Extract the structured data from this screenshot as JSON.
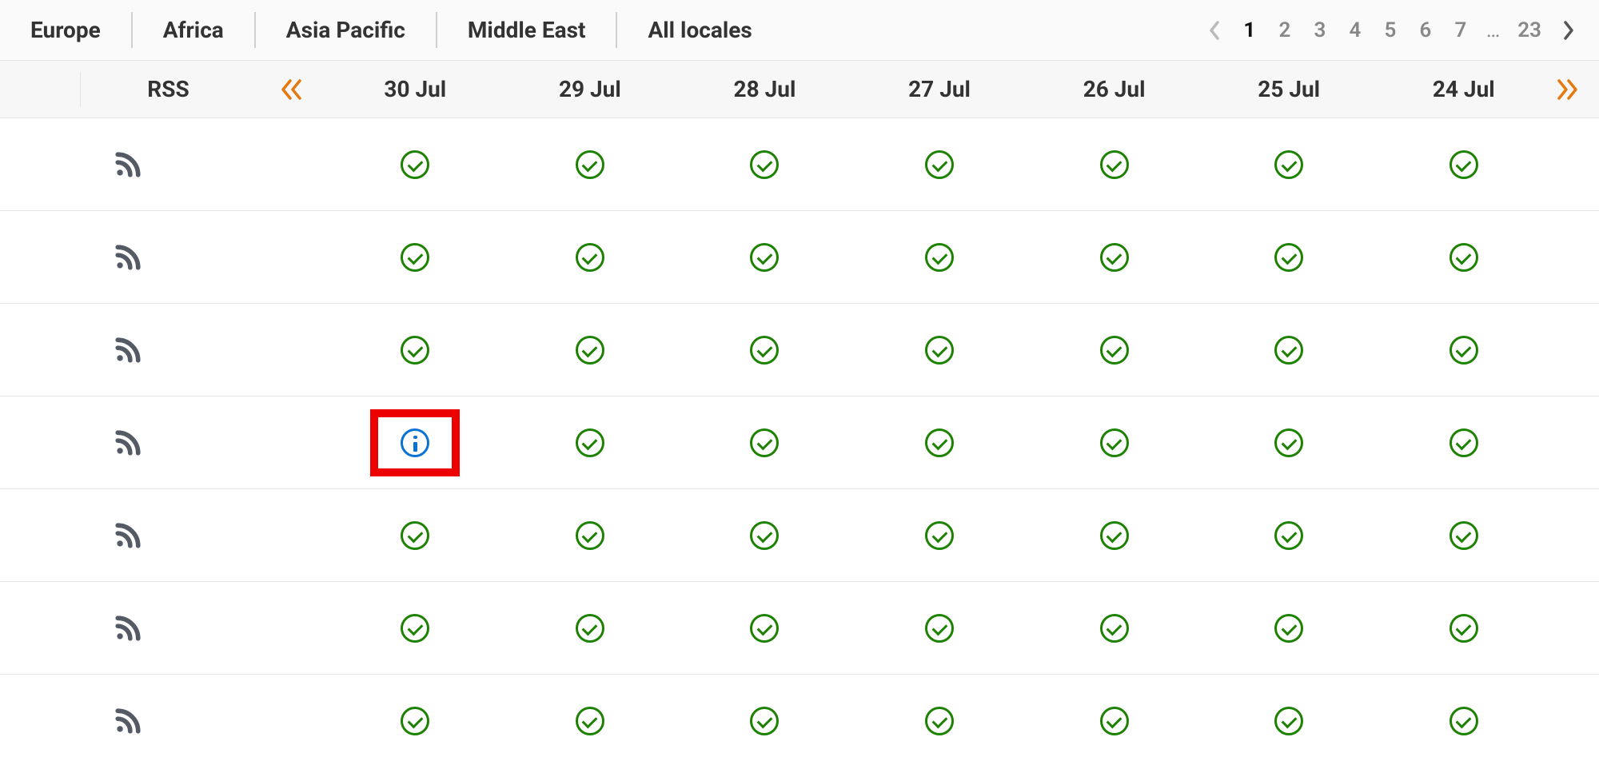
{
  "tabs": [
    {
      "label": "Europe"
    },
    {
      "label": "Africa"
    },
    {
      "label": "Asia Pacific"
    },
    {
      "label": "Middle East"
    },
    {
      "label": "All locales"
    }
  ],
  "pagination": {
    "pages": [
      "1",
      "2",
      "3",
      "4",
      "5",
      "6",
      "7"
    ],
    "ellipsis": "…",
    "last": "23",
    "active": "1"
  },
  "header": {
    "rss_label": "RSS",
    "dates": [
      "30 Jul",
      "29 Jul",
      "28 Jul",
      "27 Jul",
      "26 Jul",
      "25 Jul",
      "24 Jul"
    ]
  },
  "rows": [
    {
      "statuses": [
        "ok",
        "ok",
        "ok",
        "ok",
        "ok",
        "ok",
        "ok"
      ],
      "highlight": null
    },
    {
      "statuses": [
        "ok",
        "ok",
        "ok",
        "ok",
        "ok",
        "ok",
        "ok"
      ],
      "highlight": null
    },
    {
      "statuses": [
        "ok",
        "ok",
        "ok",
        "ok",
        "ok",
        "ok",
        "ok"
      ],
      "highlight": null
    },
    {
      "statuses": [
        "info",
        "ok",
        "ok",
        "ok",
        "ok",
        "ok",
        "ok"
      ],
      "highlight": 0
    },
    {
      "statuses": [
        "ok",
        "ok",
        "ok",
        "ok",
        "ok",
        "ok",
        "ok"
      ],
      "highlight": null
    },
    {
      "statuses": [
        "ok",
        "ok",
        "ok",
        "ok",
        "ok",
        "ok",
        "ok"
      ],
      "highlight": null
    },
    {
      "statuses": [
        "ok",
        "ok",
        "ok",
        "ok",
        "ok",
        "ok",
        "ok"
      ],
      "highlight": null
    }
  ]
}
